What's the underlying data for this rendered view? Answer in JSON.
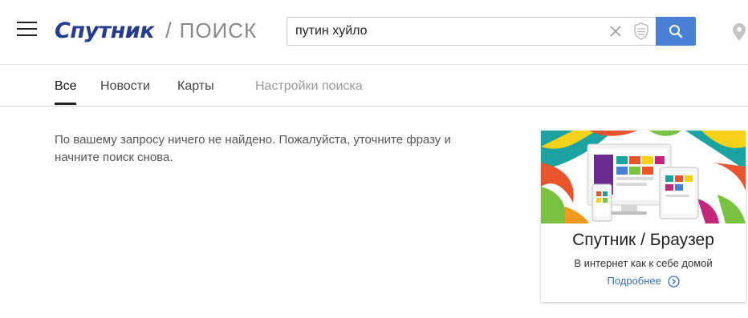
{
  "header": {
    "logo_brand": "Спутник",
    "logo_separator": "/",
    "logo_section": "ПОИСК",
    "search": {
      "value": "путин хуйло"
    },
    "accent_color": "#4a7fd6",
    "icons": [
      "menu-icon",
      "close-icon",
      "shield-icon",
      "search-icon",
      "location-pin-icon"
    ]
  },
  "tabs": [
    {
      "label": "Все",
      "active": true
    },
    {
      "label": "Новости",
      "active": false
    },
    {
      "label": "Карты",
      "active": false
    },
    {
      "label": "Настройки поиска",
      "active": false
    }
  ],
  "main": {
    "message_line1": "По вашему запросу ничего не найдено. Пожалуйста, уточните фразу и",
    "message_line2": "начните поиск снова."
  },
  "promo": {
    "title": "Спутник / Браузер",
    "subtitle": "В интернет как к себе домой",
    "link": "Подробнее"
  }
}
